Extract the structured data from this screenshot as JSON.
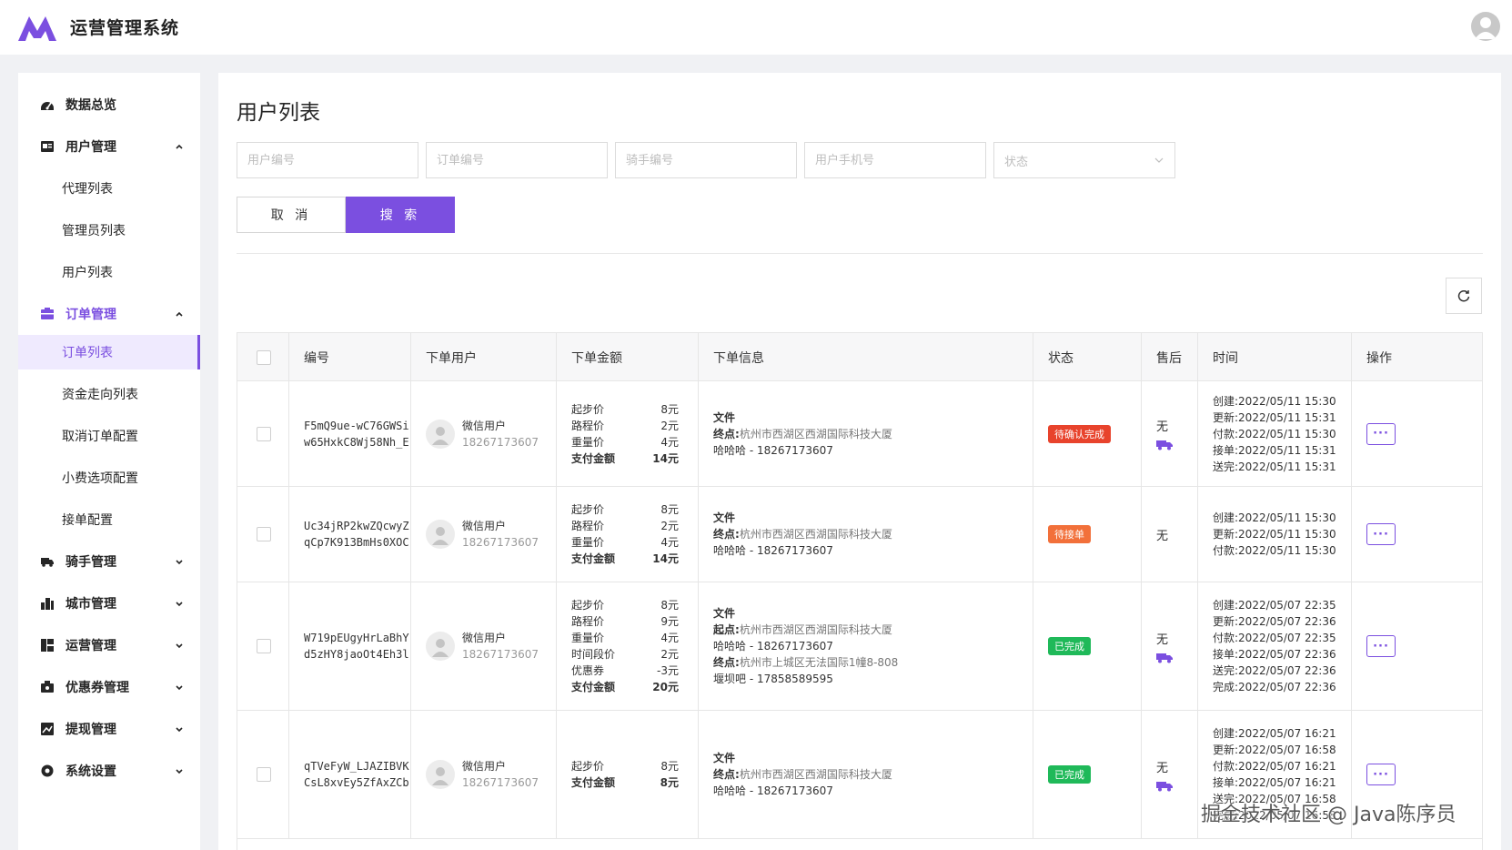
{
  "header": {
    "title": "运营管理系统",
    "brand_color": "#7b4fe0"
  },
  "sidebar": {
    "items": [
      {
        "label": "数据总览",
        "icon": "dashboard-icon"
      },
      {
        "label": "用户管理",
        "icon": "user-card-icon",
        "expanded": true
      },
      {
        "label": "代理列表"
      },
      {
        "label": "管理员列表"
      },
      {
        "label": "用户列表"
      },
      {
        "label": "订单管理",
        "icon": "order-icon",
        "expanded": true
      },
      {
        "label": "订单列表",
        "active": true
      },
      {
        "label": "资金走向列表"
      },
      {
        "label": "取消订单配置"
      },
      {
        "label": "小费选项配置"
      },
      {
        "label": "接单配置"
      },
      {
        "label": "骑手管理",
        "icon": "truck-icon"
      },
      {
        "label": "城市管理",
        "icon": "city-icon"
      },
      {
        "label": "运营管理",
        "icon": "operation-icon"
      },
      {
        "label": "优惠券管理",
        "icon": "coupon-icon"
      },
      {
        "label": "提现管理",
        "icon": "withdraw-icon"
      },
      {
        "label": "系统设置",
        "icon": "gear-icon"
      }
    ]
  },
  "main": {
    "title": "用户列表",
    "filters": {
      "user_id_placeholder": "用户编号",
      "order_id_placeholder": "订单编号",
      "rider_id_placeholder": "骑手编号",
      "phone_placeholder": "用户手机号",
      "status_placeholder": "状态"
    },
    "buttons": {
      "cancel": "取 消",
      "search": "搜 索"
    },
    "table": {
      "headers": [
        "编号",
        "下单用户",
        "下单金额",
        "下单信息",
        "状态",
        "售后",
        "时间",
        "操作"
      ],
      "rows": [
        {
          "id": "F5mQ9ue-wC76GWSiw65HxkC8Wj58Nh_E",
          "user_name": "微信用户",
          "user_phone": "18267173607",
          "amounts": [
            {
              "label": "起步价",
              "value": "8元"
            },
            {
              "label": "路程价",
              "value": "2元"
            },
            {
              "label": "重量价",
              "value": "4元"
            },
            {
              "label": "支付金额",
              "value": "14元",
              "total": true
            }
          ],
          "info": [
            {
              "text": "文件",
              "bold": true
            },
            {
              "prefix": "终点:",
              "text": "杭州市西湖区西湖国际科技大厦"
            },
            {
              "text": "哈哈哈 - 18267173607"
            }
          ],
          "status": "待确认完成",
          "status_color": "#e8432c",
          "after_sale": "无",
          "truck": true,
          "times": [
            "创建:2022/05/11 15:30",
            "更新:2022/05/11 15:31",
            "付款:2022/05/11 15:30",
            "接单:2022/05/11 15:31",
            "送完:2022/05/11 15:31"
          ]
        },
        {
          "id": "Uc34jRP2kwZQcwyZqCp7K913BmHs0XOC",
          "user_name": "微信用户",
          "user_phone": "18267173607",
          "amounts": [
            {
              "label": "起步价",
              "value": "8元"
            },
            {
              "label": "路程价",
              "value": "2元"
            },
            {
              "label": "重量价",
              "value": "4元"
            },
            {
              "label": "支付金额",
              "value": "14元",
              "total": true
            }
          ],
          "info": [
            {
              "text": "文件",
              "bold": true
            },
            {
              "prefix": "终点:",
              "text": "杭州市西湖区西湖国际科技大厦"
            },
            {
              "text": "哈哈哈 - 18267173607"
            }
          ],
          "status": "待接单",
          "status_color": "#f2703a",
          "after_sale": "无",
          "truck": false,
          "times": [
            "创建:2022/05/11 15:30",
            "更新:2022/05/11 15:30",
            "付款:2022/05/11 15:30"
          ]
        },
        {
          "id": "W719pEUgyHrLaBhYd5zHY8jaoOt4Eh3l",
          "user_name": "微信用户",
          "user_phone": "18267173607",
          "amounts": [
            {
              "label": "起步价",
              "value": "8元"
            },
            {
              "label": "路程价",
              "value": "9元"
            },
            {
              "label": "重量价",
              "value": "4元"
            },
            {
              "label": "时间段价",
              "value": "2元"
            },
            {
              "label": "优惠券",
              "value": "-3元"
            },
            {
              "label": "支付金额",
              "value": "20元",
              "total": true
            }
          ],
          "info": [
            {
              "text": "文件",
              "bold": true
            },
            {
              "prefix": "起点:",
              "text": "杭州市西湖区西湖国际科技大厦"
            },
            {
              "text": "哈哈哈 - 18267173607"
            },
            {
              "prefix": "终点:",
              "text": "杭州市上城区无法国际1幢8-808"
            },
            {
              "text": "堰坝吧 - 17858589595"
            }
          ],
          "status": "已完成",
          "status_color": "#1fb959",
          "after_sale": "无",
          "truck": true,
          "times": [
            "创建:2022/05/07 22:35",
            "更新:2022/05/07 22:36",
            "付款:2022/05/07 22:35",
            "接单:2022/05/07 22:36",
            "送完:2022/05/07 22:36",
            "完成:2022/05/07 22:36"
          ]
        },
        {
          "id": "qTVeFyW_LJAZIBVKCsL8xvEy5ZfAxZCb",
          "user_name": "微信用户",
          "user_phone": "18267173607",
          "amounts": [
            {
              "label": "起步价",
              "value": "8元"
            },
            {
              "label": "支付金额",
              "value": "8元",
              "total": true
            }
          ],
          "info": [
            {
              "text": "文件",
              "bold": true
            },
            {
              "prefix": "终点:",
              "text": "杭州市西湖区西湖国际科技大厦"
            },
            {
              "text": "哈哈哈 - 18267173607"
            }
          ],
          "status": "已完成",
          "status_color": "#1fb959",
          "after_sale": "无",
          "truck": true,
          "times": [
            "创建:2022/05/07 16:21",
            "更新:2022/05/07 16:58",
            "付款:2022/05/07 16:21",
            "接单:2022/05/07 16:21",
            "送完:2022/05/07 16:58",
            "完成:2022/05/07 16:58"
          ]
        }
      ]
    }
  },
  "watermark": "掘金技术社区 @ Java陈序员"
}
